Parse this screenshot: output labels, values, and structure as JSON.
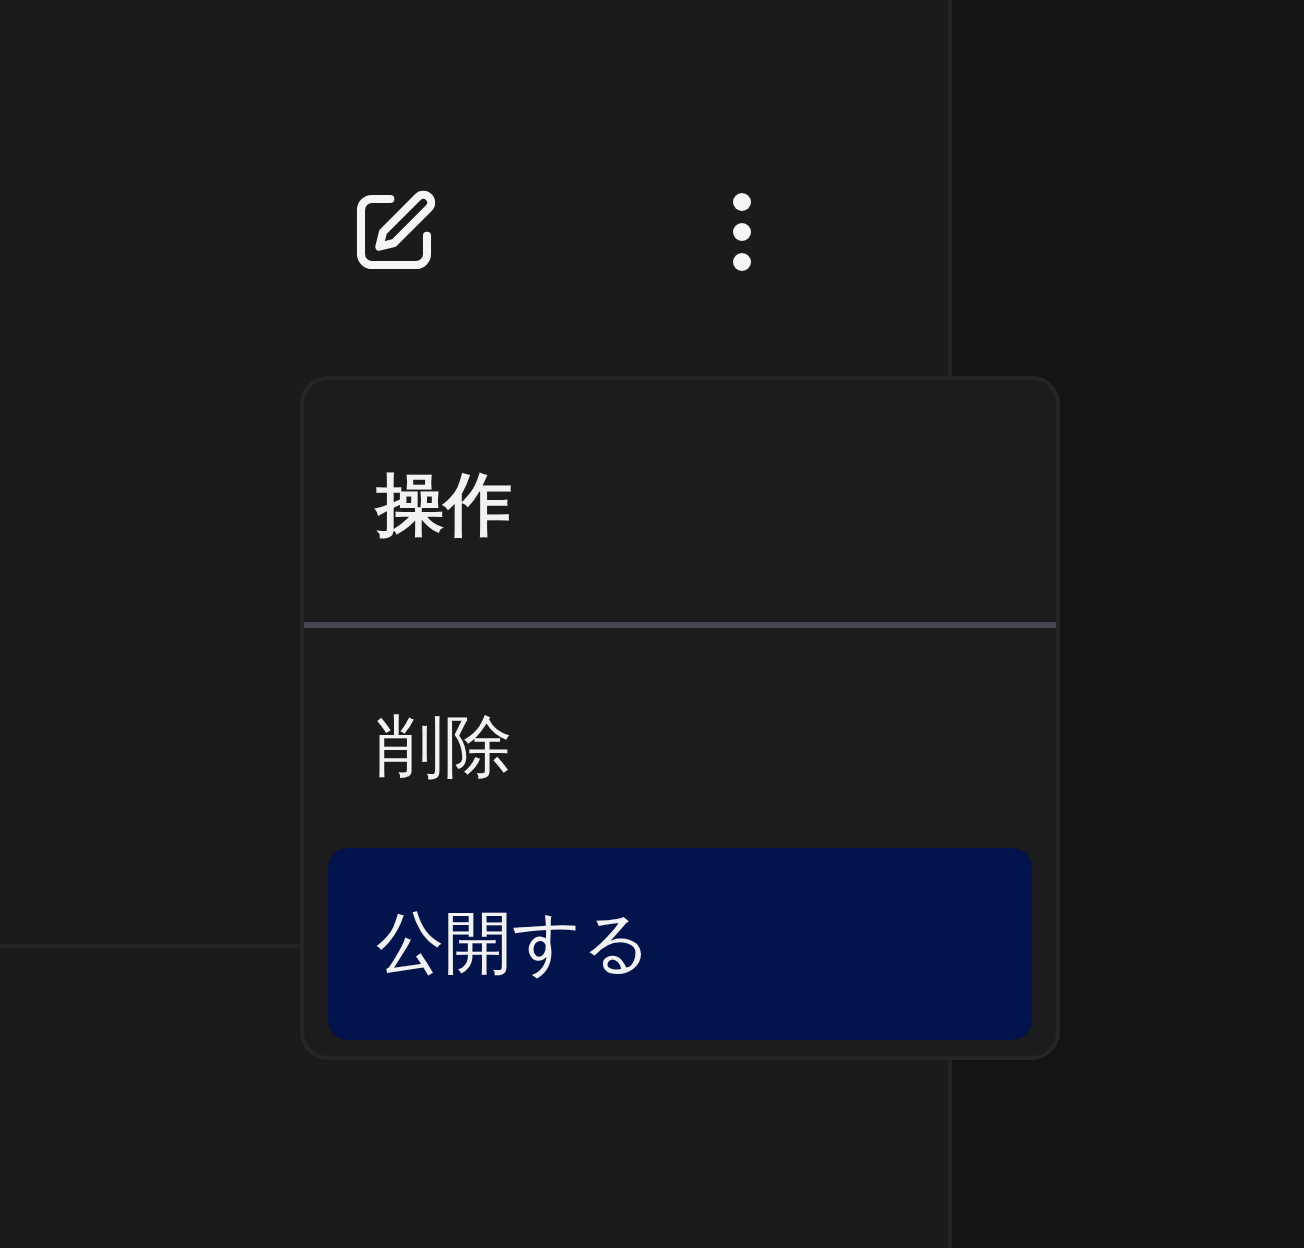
{
  "menu": {
    "title": "操作",
    "items": [
      {
        "label": "削除",
        "selected": false
      },
      {
        "label": "公開する",
        "selected": true
      }
    ]
  }
}
